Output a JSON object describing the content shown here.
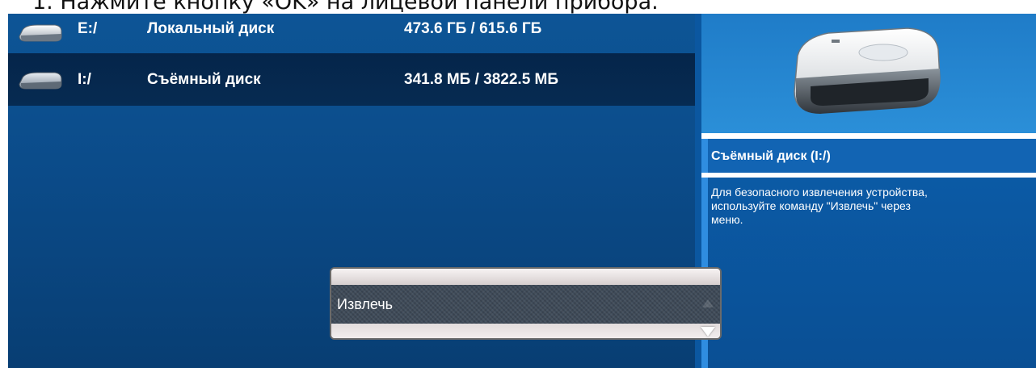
{
  "instruction": {
    "text": "1. Нажмите кнопку «OK» на лицевой панели прибора."
  },
  "drives": [
    {
      "letter": "E:/",
      "name": "Локальный диск",
      "size": "473.6 ГБ / 615.6 ГБ",
      "icon": "hard-drive-icon",
      "selected": false
    },
    {
      "letter": "I:/",
      "name": "Съёмный диск",
      "size": "341.8 МБ / 3822.5 МБ",
      "icon": "removable-drive-icon",
      "selected": true
    }
  ],
  "details": {
    "image": "hard-drive-large-icon",
    "title": "Съёмный диск (I:/)",
    "description": "Для безопасного извлечения устройства,\nиспользуйте команду \"Извлечь\" через\nменю."
  },
  "context_menu": {
    "items": [
      "Извлечь"
    ],
    "scroll_up_icon": "chevron-up-icon",
    "scroll_down_icon": "chevron-down-icon"
  },
  "colors": {
    "panel": "#0b4b89",
    "selected_row": "#05254a",
    "accent": "#2f8de0"
  }
}
